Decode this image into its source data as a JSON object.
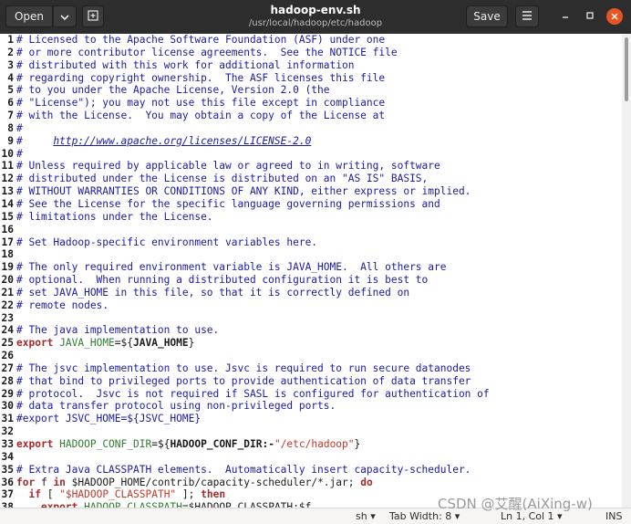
{
  "header": {
    "open_label": "Open",
    "save_label": "Save",
    "title": "hadoop-env.sh",
    "path": "/usr/local/hadoop/etc/hadoop",
    "icons": [
      "chevron-down-icon",
      "new-tab-icon",
      "hamburger-menu-icon",
      "minimize-icon",
      "maximize-icon",
      "close-icon"
    ]
  },
  "editor": {
    "lines": [
      {
        "n": "1",
        "segs": [
          {
            "t": "# Licensed to the Apache Software Foundation (ASF) under one",
            "c": "comment"
          }
        ]
      },
      {
        "n": "2",
        "segs": [
          {
            "t": "# or more contributor license agreements.  See the NOTICE file",
            "c": "comment"
          }
        ]
      },
      {
        "n": "3",
        "segs": [
          {
            "t": "# distributed with this work for additional information",
            "c": "comment"
          }
        ]
      },
      {
        "n": "4",
        "segs": [
          {
            "t": "# regarding copyright ownership.  The ASF licenses this file",
            "c": "comment"
          }
        ]
      },
      {
        "n": "5",
        "segs": [
          {
            "t": "# to you under the Apache License, Version 2.0 (the",
            "c": "comment"
          }
        ]
      },
      {
        "n": "6",
        "segs": [
          {
            "t": "# \"License\"); you may not use this file except in compliance",
            "c": "comment"
          }
        ]
      },
      {
        "n": "7",
        "segs": [
          {
            "t": "# with the License.  You may obtain a copy of the License at",
            "c": "comment"
          }
        ]
      },
      {
        "n": "8",
        "segs": [
          {
            "t": "#",
            "c": "comment"
          }
        ]
      },
      {
        "n": "9",
        "segs": [
          {
            "t": "#     ",
            "c": "comment"
          },
          {
            "t": "http://www.apache.org/licenses/LICENSE-2.0",
            "c": "link"
          }
        ]
      },
      {
        "n": "10",
        "segs": [
          {
            "t": "#",
            "c": "comment"
          }
        ]
      },
      {
        "n": "11",
        "segs": [
          {
            "t": "# Unless required by applicable law or agreed to in writing, software",
            "c": "comment"
          }
        ]
      },
      {
        "n": "12",
        "segs": [
          {
            "t": "# distributed under the License is distributed on an \"AS IS\" BASIS,",
            "c": "comment"
          }
        ]
      },
      {
        "n": "13",
        "segs": [
          {
            "t": "# WITHOUT WARRANTIES OR CONDITIONS OF ANY KIND, either express or implied.",
            "c": "comment"
          }
        ]
      },
      {
        "n": "14",
        "segs": [
          {
            "t": "# See the License for the specific language governing permissions and",
            "c": "comment"
          }
        ]
      },
      {
        "n": "15",
        "segs": [
          {
            "t": "# limitations under the License.",
            "c": "comment"
          }
        ]
      },
      {
        "n": "16",
        "segs": []
      },
      {
        "n": "17",
        "segs": [
          {
            "t": "# Set Hadoop-specific environment variables here.",
            "c": "comment"
          }
        ]
      },
      {
        "n": "18",
        "segs": []
      },
      {
        "n": "19",
        "segs": [
          {
            "t": "# The only required environment variable is JAVA_HOME.  All others are",
            "c": "comment"
          }
        ]
      },
      {
        "n": "20",
        "segs": [
          {
            "t": "# optional.  When running a distributed configuration it is best to",
            "c": "comment"
          }
        ]
      },
      {
        "n": "21",
        "segs": [
          {
            "t": "# set JAVA_HOME in this file, so that it is correctly defined on",
            "c": "comment"
          }
        ]
      },
      {
        "n": "22",
        "segs": [
          {
            "t": "# remote nodes.",
            "c": "comment"
          }
        ]
      },
      {
        "n": "23",
        "segs": []
      },
      {
        "n": "24",
        "segs": [
          {
            "t": "# The java implementation to use.",
            "c": "comment"
          }
        ]
      },
      {
        "n": "25",
        "segs": [
          {
            "t": "export",
            "c": "kw"
          },
          {
            "t": " ",
            "c": "plain"
          },
          {
            "t": "JAVA_HOME",
            "c": "var"
          },
          {
            "t": "=${",
            "c": "plain"
          },
          {
            "t": "JAVA_HOME",
            "c": "exp"
          },
          {
            "t": "}",
            "c": "plain"
          }
        ]
      },
      {
        "n": "26",
        "segs": []
      },
      {
        "n": "27",
        "segs": [
          {
            "t": "# The jsvc implementation to use. Jsvc is required to run secure datanodes",
            "c": "comment"
          }
        ]
      },
      {
        "n": "28",
        "segs": [
          {
            "t": "# that bind to privileged ports to provide authentication of data transfer",
            "c": "comment"
          }
        ]
      },
      {
        "n": "29",
        "segs": [
          {
            "t": "# protocol.  Jsvc is not required if SASL is configured for authentication of",
            "c": "comment"
          }
        ]
      },
      {
        "n": "30",
        "segs": [
          {
            "t": "# data transfer protocol using non-privileged ports.",
            "c": "comment"
          }
        ]
      },
      {
        "n": "31",
        "segs": [
          {
            "t": "#export JSVC_HOME=${JSVC_HOME}",
            "c": "comment"
          }
        ]
      },
      {
        "n": "32",
        "segs": []
      },
      {
        "n": "33",
        "segs": [
          {
            "t": "export",
            "c": "kw"
          },
          {
            "t": " ",
            "c": "plain"
          },
          {
            "t": "HADOOP_CONF_DIR",
            "c": "var"
          },
          {
            "t": "=${",
            "c": "plain"
          },
          {
            "t": "HADOOP_CONF_DIR:-",
            "c": "exp"
          },
          {
            "t": "\"/etc/hadoop\"",
            "c": "str"
          },
          {
            "t": "}",
            "c": "plain"
          }
        ]
      },
      {
        "n": "34",
        "segs": []
      },
      {
        "n": "35",
        "segs": [
          {
            "t": "# Extra Java CLASSPATH elements.  Automatically insert capacity-scheduler.",
            "c": "comment"
          }
        ]
      },
      {
        "n": "36",
        "segs": [
          {
            "t": "for",
            "c": "kw"
          },
          {
            "t": " f ",
            "c": "plain"
          },
          {
            "t": "in",
            "c": "kw"
          },
          {
            "t": " $HADOOP_HOME/contrib/capacity-scheduler/*.jar; ",
            "c": "plain"
          },
          {
            "t": "do",
            "c": "kw"
          }
        ]
      },
      {
        "n": "37",
        "segs": [
          {
            "t": "  ",
            "c": "plain"
          },
          {
            "t": "if",
            "c": "kw"
          },
          {
            "t": " [ ",
            "c": "plain"
          },
          {
            "t": "\"$HADOOP_CLASSPATH\"",
            "c": "str"
          },
          {
            "t": " ]; ",
            "c": "plain"
          },
          {
            "t": "then",
            "c": "kw"
          }
        ]
      },
      {
        "n": "38",
        "segs": [
          {
            "t": "    ",
            "c": "plain"
          },
          {
            "t": "export",
            "c": "kw"
          },
          {
            "t": " ",
            "c": "plain"
          },
          {
            "t": "HADOOP_CLASSPATH",
            "c": "var"
          },
          {
            "t": "=$HADOOP_CLASSPATH:$f",
            "c": "plain"
          }
        ]
      }
    ]
  },
  "statusbar": {
    "language": "sh",
    "tab_width": "Tab Width: 8",
    "position": "Ln 1, Col 1",
    "mode": "INS"
  },
  "watermark": "CSDN @艾醒(AiXing-w)",
  "colors": {
    "header_bg": "#2d2d2d",
    "close_button": "#e95420",
    "comment": "#1a1aa6",
    "keyword": "#a52a2a",
    "variable": "#2e7d32",
    "string": "#c0392b"
  }
}
